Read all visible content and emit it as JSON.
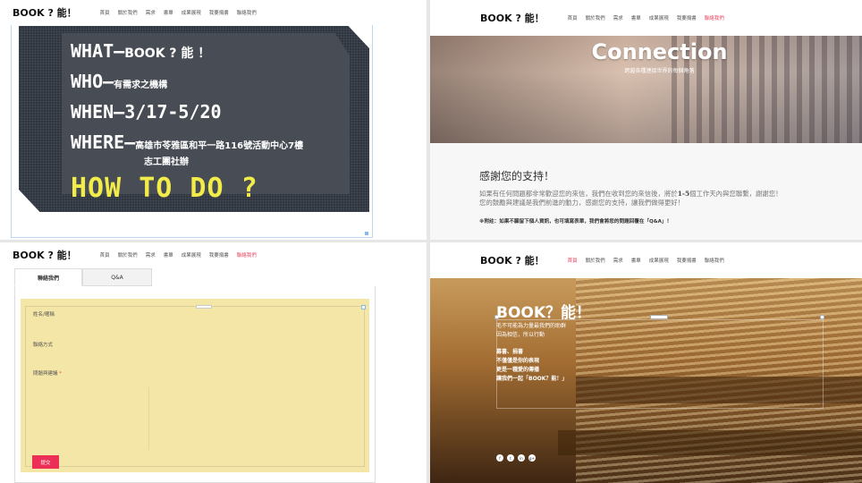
{
  "nav": {
    "logo": "BOOK ? 能！",
    "items": [
      "首頁",
      "關於我們",
      "需求",
      "書單",
      "成果展現",
      "我要捐書",
      "聯絡我們"
    ]
  },
  "q1": {
    "what_label": "WHAT—",
    "what_value": "BOOK ? 能 ！",
    "who_label": "WHO—",
    "who_value": "有需求之機構",
    "when_label": "WHEN—",
    "when_value": "3/17-5/20",
    "where_label": "WHERE—",
    "where_value": "高雄市苓雅區和平一路116號活動中心7樓",
    "where_value2": "志工團社辦",
    "how": "HOW TO DO ?"
  },
  "q2": {
    "hero_title": "Connection",
    "hero_subtitle": "跨越各種連接世界的每個角落",
    "heading": "感謝您的支持！",
    "text_before_bold": "如果有任何問題都非常歡迎您的來信，我們在收到您的來信後，將於",
    "text_bold": "1-5",
    "text_after_bold": "個工作天內與您聯繫，謝謝您！",
    "text_line2": "您的鼓勵與建議是我們前進的動力，感謝您的支持，讓我們做得更好！",
    "note": "※附註：如果不願留下個人資訊，也可填寫表單，我們會將您的問題回覆在「Q&A」！"
  },
  "q3": {
    "tab_contact": "聯絡我們",
    "tab_qa": "Q&A",
    "field_name": "姓名/暱稱",
    "field_contact": "聯絡方式",
    "field_question": "問題與建議",
    "required_mark": "*",
    "submit": "提交"
  },
  "q4": {
    "title": "BOOK？能！",
    "line1": "毛不可能為力量最我們的助群",
    "line2": "因為相信，所以行動",
    "line3": "募書、捐書",
    "line4": "不僅僅是你的表現",
    "line5": "更是一種愛的傳播",
    "line6": "讓我們一起「BOOK？能！」",
    "social": [
      "f",
      "t",
      "in",
      "g+"
    ]
  }
}
